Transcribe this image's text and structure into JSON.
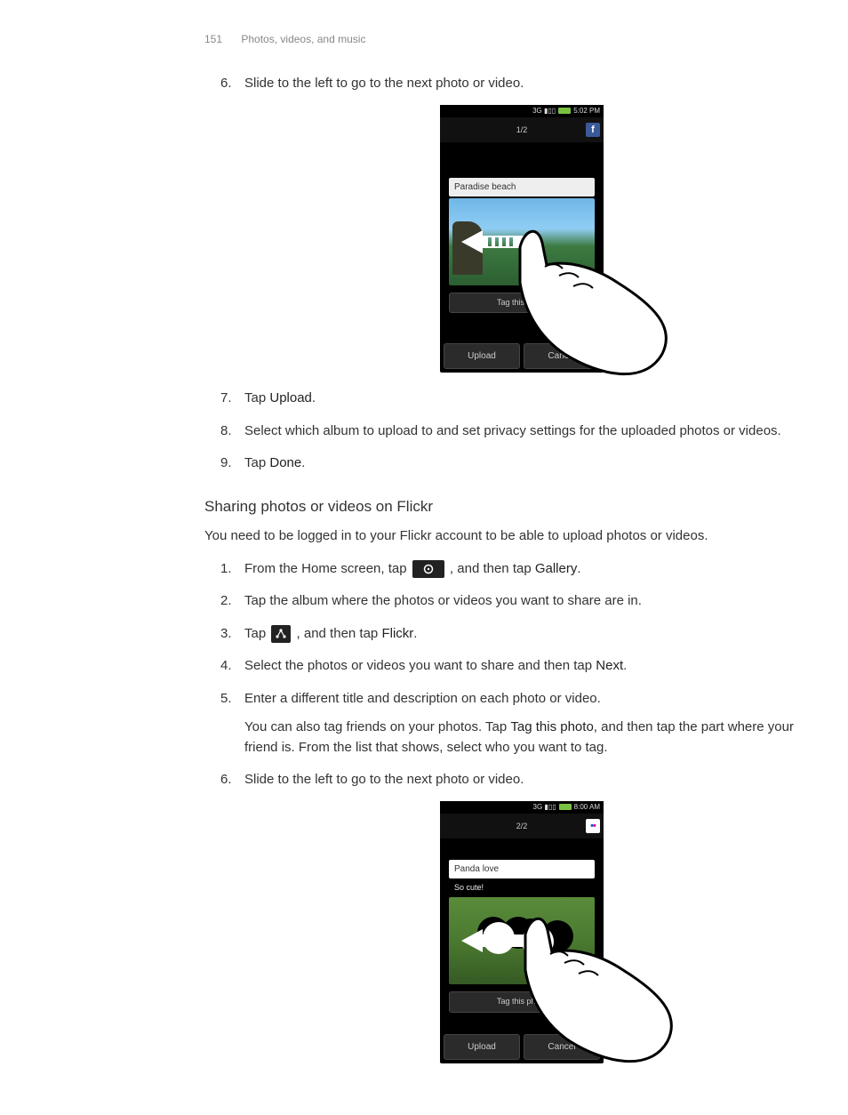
{
  "header": {
    "page_number": "151",
    "chapter": "Photos, videos, and music"
  },
  "steps_a": {
    "s6": {
      "num": "6.",
      "text": "Slide to the left to go to the next photo or video."
    },
    "s7": {
      "num": "7.",
      "pre": "Tap ",
      "bold": "Upload",
      "post": "."
    },
    "s8": {
      "num": "8.",
      "text": "Select which album to upload to and set privacy settings for the uploaded photos or videos."
    },
    "s9": {
      "num": "9.",
      "pre": "Tap ",
      "bold": "Done",
      "post": "."
    }
  },
  "section_title": "Sharing photos or videos on Flickr",
  "intro": "You need to be logged in to your Flickr account to be able to upload photos or videos.",
  "steps_b": {
    "s1": {
      "num": "1.",
      "pre": "From the Home screen, tap ",
      "mid": ", and then tap ",
      "bold": "Gallery",
      "post": "."
    },
    "s2": {
      "num": "2.",
      "text": "Tap the album where the photos or videos you want to share are in."
    },
    "s3": {
      "num": "3.",
      "pre": "Tap ",
      "mid": ", and then tap ",
      "bold": "Flickr",
      "post": "."
    },
    "s4": {
      "num": "4.",
      "pre": "Select the photos or videos you want to share and then tap ",
      "bold": "Next",
      "post": "."
    },
    "s5": {
      "num": "5.",
      "text": "Enter a different title and description on each photo or video.",
      "sub_pre": "You can also tag friends on your photos. Tap ",
      "sub_bold": "Tag this photo",
      "sub_post": ", and then tap the part where your friend is. From the list that shows, select who you want to tag."
    },
    "s6": {
      "num": "6.",
      "text": "Slide to the left to go to the next photo or video."
    }
  },
  "phone1": {
    "time": "5:02 PM",
    "counter": "1/2",
    "caption": "Paradise beach",
    "tag": "Tag this photo",
    "upload": "Upload",
    "cancel": "Cancel",
    "signal": "3G ▮▯▯"
  },
  "phone2": {
    "time": "8:00 AM",
    "counter": "2/2",
    "caption": "Panda love",
    "desc": "So cute!",
    "tag": "Tag this photo",
    "upload": "Upload",
    "cancel": "Cancel",
    "signal": "3G ▮▯▯"
  }
}
